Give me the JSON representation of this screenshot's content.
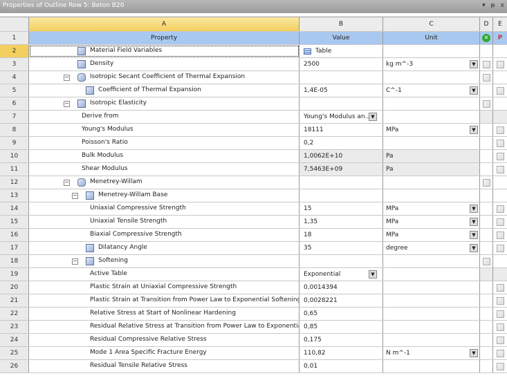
{
  "window": {
    "title": "Properties of Outline Row 5: Beton B20",
    "controls": [
      "▾",
      "ᵽ",
      "x"
    ]
  },
  "columns": {
    "letters": [
      "A",
      "B",
      "C",
      "D",
      "E"
    ],
    "headers": {
      "property": "Property",
      "value": "Value",
      "unit": "Unit"
    }
  },
  "rows": [
    {
      "n": "1"
    },
    {
      "n": "2",
      "label": "Material Field Variables",
      "indent": 70,
      "icon": "material",
      "value": "Table",
      "value_icon": true,
      "selected": true
    },
    {
      "n": "3",
      "label": "Density",
      "indent": 70,
      "icon": "material",
      "value": "2500",
      "unit": "kg m^-3",
      "unit_dd": true,
      "d": "box",
      "e": "box"
    },
    {
      "n": "4",
      "label": "Isotropic Secant Coefficient of Thermal Expansion",
      "indent": 70,
      "icon": "group",
      "minus": 50,
      "d": "box"
    },
    {
      "n": "5",
      "label": "Coefficient of Thermal Expansion",
      "indent": 82,
      "icon": "material",
      "value": "1,4E-05",
      "unit": "C^-1",
      "unit_dd": true,
      "e": "box"
    },
    {
      "n": "6",
      "label": "Isotropic Elasticity",
      "indent": 70,
      "icon": "material",
      "minus": 50,
      "d": "box"
    },
    {
      "n": "7",
      "label": "Derive from",
      "indent": 76,
      "value": "Young's Modulus an...",
      "value_dd": true,
      "d": "grey",
      "e": "grey"
    },
    {
      "n": "8",
      "label": "Young's Modulus",
      "indent": 76,
      "value": "18111",
      "unit": "MPa",
      "unit_dd": true,
      "e": "box"
    },
    {
      "n": "9",
      "label": "Poisson's Ratio",
      "indent": 76,
      "value": "0,2",
      "e": "box"
    },
    {
      "n": "10",
      "label": "Bulk Modulus",
      "indent": 76,
      "value": "1,0062E+10",
      "unit": "Pa",
      "greyval": true,
      "e": "box"
    },
    {
      "n": "11",
      "label": "Shear Modulus",
      "indent": 76,
      "value": "7,5463E+09",
      "unit": "Pa",
      "greyval": true,
      "e": "box"
    },
    {
      "n": "12",
      "label": "Menetrey-Willam",
      "indent": 70,
      "icon": "group",
      "minus": 50,
      "d": "box"
    },
    {
      "n": "13",
      "label": "Menetrey-Willam Base",
      "indent": 82,
      "icon": "material",
      "minus": 62
    },
    {
      "n": "14",
      "label": "Uniaxial Compressive Strength",
      "indent": 88,
      "value": "15",
      "unit": "MPa",
      "unit_dd": true,
      "e": "box"
    },
    {
      "n": "15",
      "label": "Uniaxial Tensile Strength",
      "indent": 88,
      "value": "1,35",
      "unit": "MPa",
      "unit_dd": true,
      "e": "box"
    },
    {
      "n": "16",
      "label": "Biaxial Compressive Strength",
      "indent": 88,
      "value": "18",
      "unit": "MPa",
      "unit_dd": true,
      "e": "box"
    },
    {
      "n": "17",
      "label": "Dilatancy Angle",
      "indent": 82,
      "icon": "material",
      "value": "35",
      "unit": "degree",
      "unit_dd": true,
      "e": "box"
    },
    {
      "n": "18",
      "label": "Softening",
      "indent": 82,
      "icon": "material",
      "minus": 62,
      "d": "box"
    },
    {
      "n": "19",
      "label": "Active Table",
      "indent": 88,
      "value": "Exponential",
      "value_dd": true,
      "d": "grey",
      "e": "grey"
    },
    {
      "n": "20",
      "label": "Plastic Strain at Uniaxial Compressive Strength",
      "indent": 88,
      "value": "0,0014394",
      "e": "box"
    },
    {
      "n": "21",
      "label": "Plastic Strain at Transition from Power Law to Exponential Softening",
      "indent": 88,
      "value": "0,0028221",
      "e": "box"
    },
    {
      "n": "22",
      "label": "Relative Stress at Start of Nonlinear Hardening",
      "indent": 88,
      "value": "0,65",
      "e": "box"
    },
    {
      "n": "23",
      "label": "Residual Relative Stress at Transition from Power Law to Exponential Softening",
      "indent": 88,
      "value": "0,85",
      "e": "box"
    },
    {
      "n": "24",
      "label": "Residual Compressive Relative Stress",
      "indent": 88,
      "value": "0,175",
      "e": "box"
    },
    {
      "n": "25",
      "label": "Mode 1 Area Specific Fracture Energy",
      "indent": 88,
      "value": "110,82",
      "unit": "N m^-1",
      "unit_dd": true,
      "e": "box"
    },
    {
      "n": "26",
      "label": "Residual Tensile Relative Stress",
      "indent": 88,
      "value": "0,01",
      "e": "box"
    }
  ],
  "colors": {
    "header_yellow": "#f2cf5f",
    "property_blue": "#a9c8ef"
  }
}
